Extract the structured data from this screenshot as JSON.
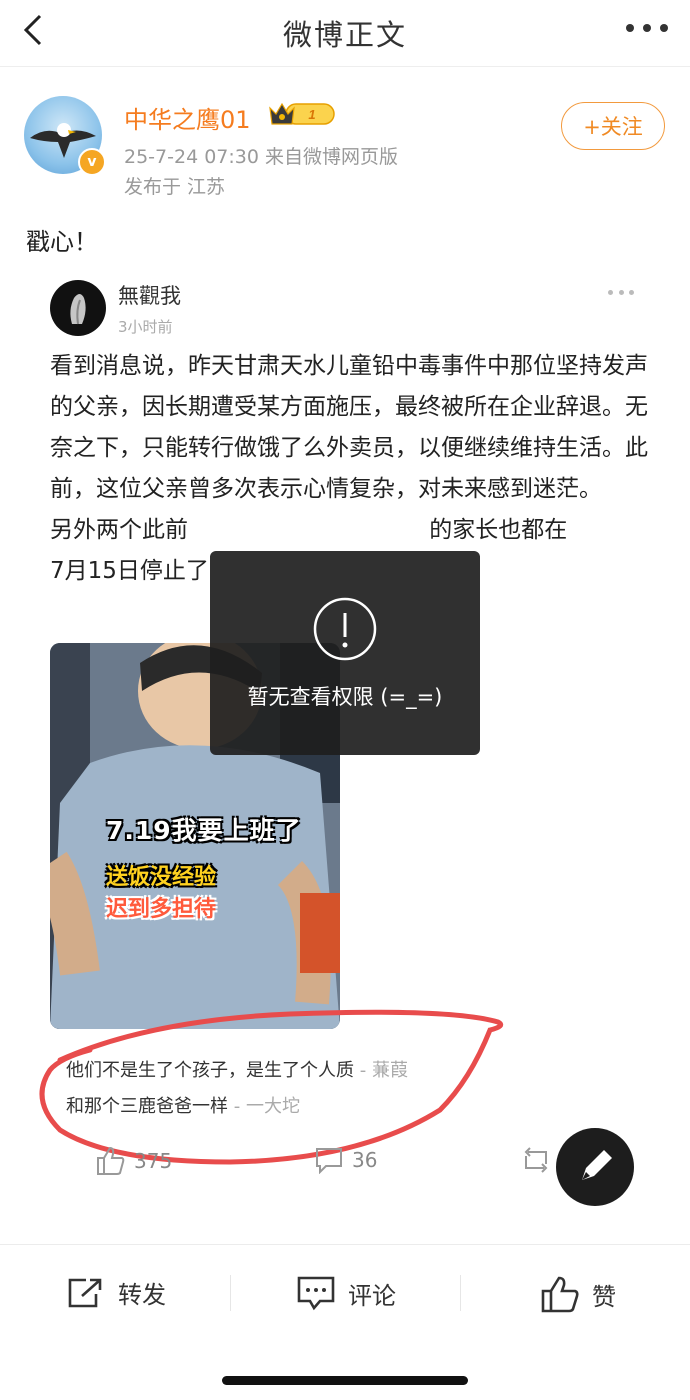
{
  "header": {
    "title": "微博正文"
  },
  "post": {
    "author": "中华之鹰01",
    "level_badge": "1",
    "meta": "25-7-24 07:30 来自微博网页版",
    "location": "发布于 江苏",
    "follow_label": "+关注",
    "text": "戳心！"
  },
  "quoted": {
    "author": "無觀我",
    "time": "3小时前",
    "paragraphs": [
      "看到消息说，昨天甘肃天水儿童铅中毒事件中那位坚持发声的父亲，因长期遭受某方面施压，最终被所在企业辞退。无奈之下，只能转行做饿了么外卖员，以便继续维持生活。此前，这位父亲曾多次表示心情复杂，对未来感到迷茫。",
      "另外两个此前                                 的家长也都在",
      "7月15日停止了"
    ],
    "photo_caption": [
      "7.19我要上班了",
      "送饭没经验",
      "迟到多担待"
    ],
    "comments": [
      {
        "text": "他们不是生了个孩子，是生了个人质",
        "by": " - 蒹葭"
      },
      {
        "text": "和那个三鹿爸爸一样",
        "by": " - 一大坨"
      }
    ],
    "likes": "375",
    "comments_count": "36"
  },
  "toast": {
    "text": "暂无查看权限 (=_=)"
  },
  "bottom_bar": {
    "repost": "转发",
    "comment": "评论",
    "like": "赞"
  },
  "colors": {
    "accent": "#f57c1f",
    "annotation": "#e84c4c"
  }
}
